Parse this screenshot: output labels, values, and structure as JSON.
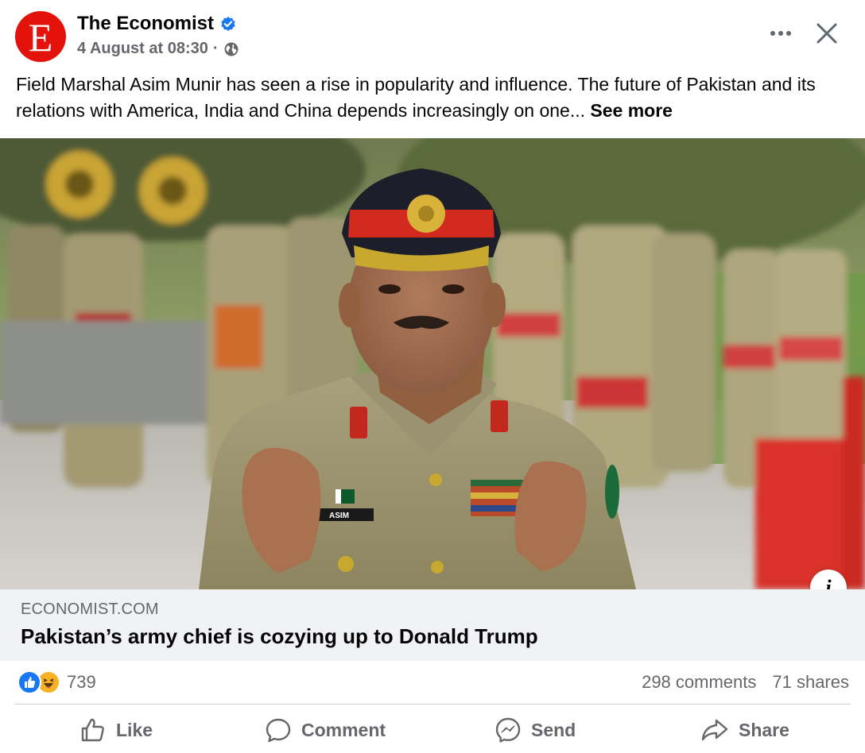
{
  "post": {
    "page_name": "The Economist",
    "avatar_letter": "E",
    "timestamp": "4 August at 08:30",
    "separator": "·",
    "text": "Field Marshal Asim Munir has seen a rise in popularity and influence. The future of Pakistan and its relations with America, India and China depends increasingly on one...",
    "see_more_label": "See more"
  },
  "link": {
    "domain": "ECONOMIST.COM",
    "title": "Pakistan’s army chief is cozying up to Donald Trump"
  },
  "photo": {
    "name_tag": "ASIM"
  },
  "stats": {
    "reaction_count": "739",
    "comments": "298 comments",
    "shares": "71 shares"
  },
  "actions": {
    "like": "Like",
    "comment": "Comment",
    "send": "Send",
    "share": "Share"
  },
  "colors": {
    "brand_red": "#e3120b",
    "facebook_blue": "#1877f2",
    "secondary_text": "#65676b",
    "link_box_bg": "#f0f2f5"
  },
  "icons": [
    "verified-badge-icon",
    "globe-icon",
    "more-options-icon",
    "close-icon",
    "info-icon",
    "like-reaction-icon",
    "haha-reaction-icon",
    "like-icon",
    "comment-icon",
    "messenger-icon",
    "share-icon"
  ]
}
